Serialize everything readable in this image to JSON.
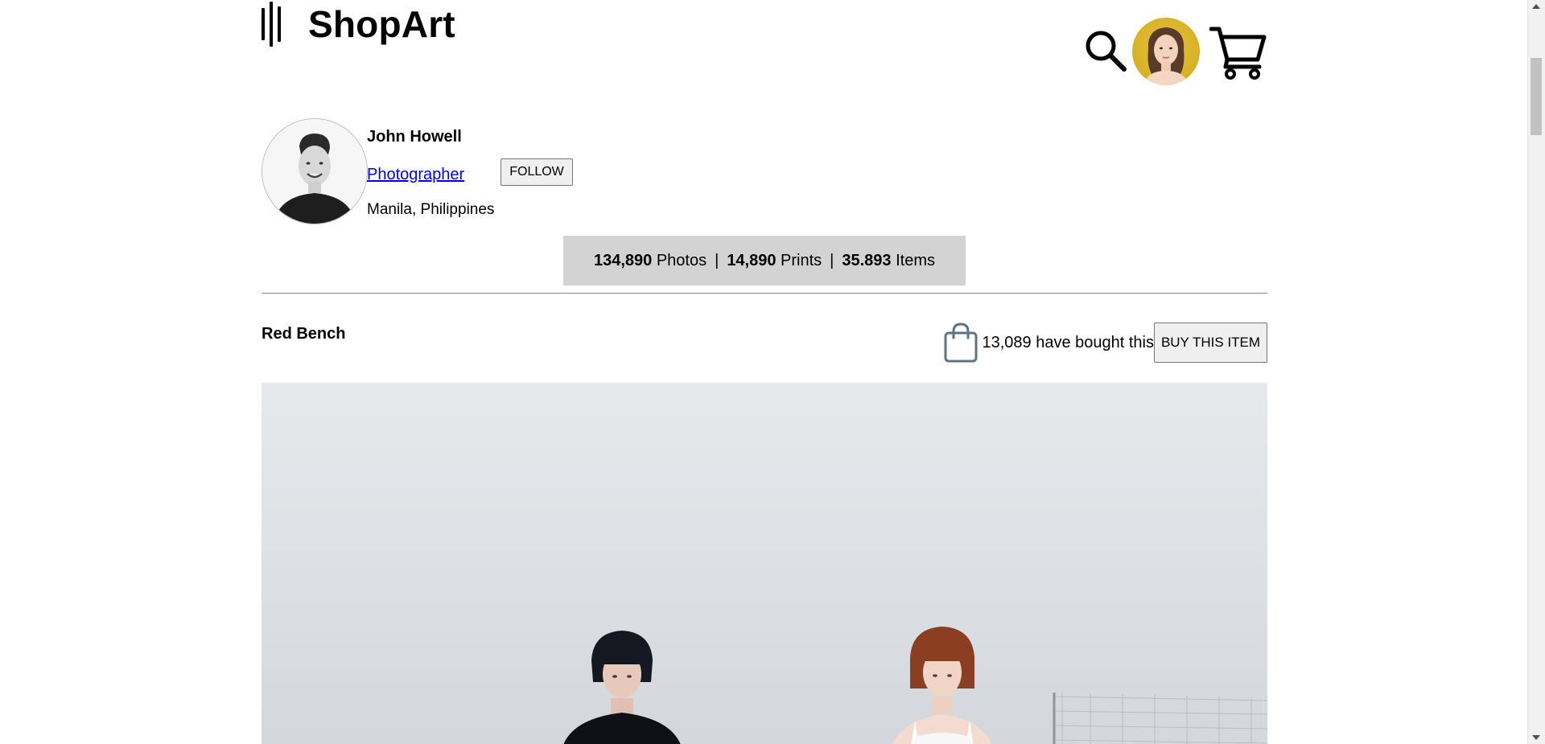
{
  "header": {
    "brand": "ShopArt",
    "icons": [
      "logo-bars-icon",
      "search-icon",
      "user-avatar",
      "cart-icon"
    ]
  },
  "profile": {
    "name": "John Howell",
    "role": "Photographer",
    "follow_label": "FOLLOW",
    "location": "Manila, Philippines"
  },
  "stats": {
    "photos_count": "134,890",
    "photos_label": "Photos",
    "prints_count": "14,890",
    "prints_label": "Prints",
    "items_count": "35.893",
    "items_label": "Items",
    "separator": "|"
  },
  "item": {
    "title": "Red Bench",
    "bought_text": "13,089 have bought this",
    "buy_label": "BUY THIS ITEM"
  },
  "colors": {
    "link": "#0000ee",
    "stats_bg": "#d3d3d3",
    "bag_icon": "#5d7387",
    "button_bg": "#efefef"
  }
}
